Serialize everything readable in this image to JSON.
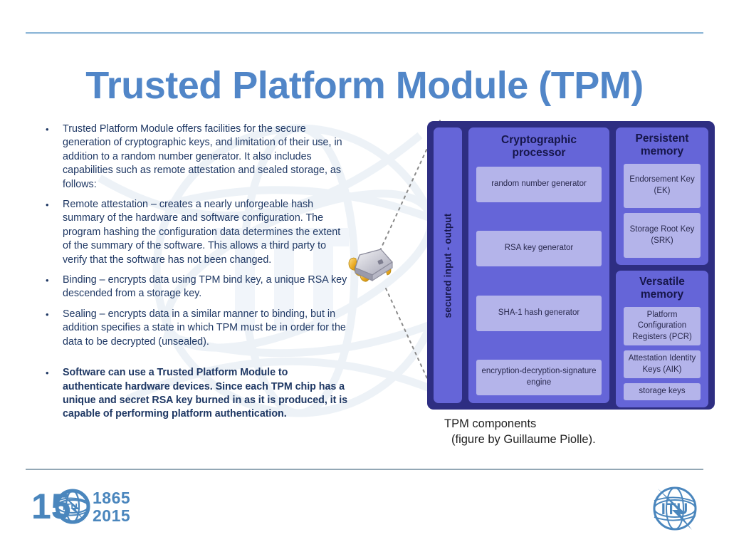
{
  "slide": {
    "title": "Trusted Platform Module (TPM)",
    "bullet_marker": "•"
  },
  "bullets": [
    {
      "text": "Trusted Platform Module offers facilities for the secure generation of cryptographic keys, and limitation of their use, in addition to a random number generator. It also includes capabilities such as remote attestation and sealed storage, as follows:",
      "bold": false
    },
    {
      "text": "Remote attestation – creates a nearly unforgeable hash summary of the hardware and software configuration. The program hashing the configuration data determines the extent of the summary of the software. This allows a third party to verify that the software has not been changed.",
      "bold": false
    },
    {
      "text": "Binding – encrypts data using TPM bind key, a unique RSA key descended from a storage key.",
      "bold": false
    },
    {
      "text": "Sealing – encrypts data in a similar manner to binding, but in addition specifies a state in which TPM must be in order for the data to be decrypted (unsealed).",
      "bold": false
    },
    {
      "text": "Software can use a Trusted Platform Module to authenticate hardware devices. Since each TPM chip has a unique and secret RSA key burned in as it is produced, it is capable of performing platform authentication.",
      "bold": true
    }
  ],
  "diagram": {
    "io_label": "secured input - output",
    "crypto": {
      "title_line1": "Cryptographic",
      "title_line2": "processor",
      "items": [
        "random number generator",
        "RSA key generator",
        "SHA-1 hash generator",
        "encryption-decryption-signature engine"
      ]
    },
    "persistent_memory": {
      "title": "Persistent memory",
      "items": [
        "Endorsement Key (EK)",
        "Storage Root Key (SRK)"
      ]
    },
    "versatile_memory": {
      "title": "Versatile memory",
      "items": [
        "Platform Configuration Registers (PCR)",
        "Attestation Identity Keys (AIK)",
        "storage keys"
      ]
    },
    "colors": {
      "outer": "#2e2e82",
      "panel": "#6565d8",
      "inner_box": "#b4b4ea",
      "text": "#16164a"
    }
  },
  "caption": {
    "line1": "TPM components",
    "line2": "(figure by Guillaume Piolle)."
  },
  "footer": {
    "anniversary_number": "150",
    "anniversary_year_from": "1865",
    "anniversary_year_to": "2015",
    "org_mark": "ITU",
    "accent_color": "#4a86bd"
  }
}
